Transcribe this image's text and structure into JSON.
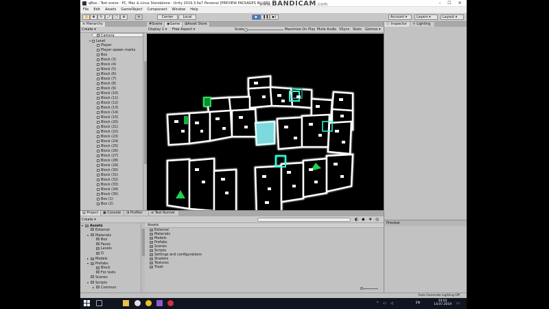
{
  "window": {
    "title": "qBox - Test scene - PC, Mac & Linux Standalone - Unity 2019.3.0a7 Personal [PREVIEW PACKAGES IN USE]",
    "watermark": "BANDICAM",
    "watermark_prefix": "www.",
    "watermark_suffix": ".com",
    "controls": [
      "–",
      "☐",
      "✕"
    ]
  },
  "menubar": [
    "File",
    "Edit",
    "Assets",
    "GameObject",
    "Component",
    "Window",
    "Help"
  ],
  "toolbar": {
    "pivot_label": "Center",
    "space_label": "Local",
    "account_label": "Account",
    "layers_label": "Layers",
    "layout_label": "Layout",
    "colors": {
      "play_active": "#3f78c9"
    }
  },
  "hierarchy": {
    "tab_label": "Hierarchy",
    "create_label": "Create",
    "search_placeholder": "All",
    "rows": [
      {
        "label": "Camera",
        "indent": 2,
        "arrow": ""
      },
      {
        "label": "Level",
        "indent": 1,
        "arrow": "▾"
      },
      {
        "label": "Player",
        "indent": 2,
        "arrow": ""
      },
      {
        "label": "Player spawn marks",
        "indent": 2,
        "arrow": ""
      },
      {
        "label": "Box",
        "indent": 2,
        "arrow": ""
      },
      {
        "label": "Block (3)",
        "indent": 2,
        "arrow": ""
      },
      {
        "label": "Block (4)",
        "indent": 2,
        "arrow": ""
      },
      {
        "label": "Block (5)",
        "indent": 2,
        "arrow": ""
      },
      {
        "label": "Block (6)",
        "indent": 2,
        "arrow": ""
      },
      {
        "label": "Block (7)",
        "indent": 2,
        "arrow": ""
      },
      {
        "label": "Block (8)",
        "indent": 2,
        "arrow": ""
      },
      {
        "label": "Block (9)",
        "indent": 2,
        "arrow": ""
      },
      {
        "label": "Block (10)",
        "indent": 2,
        "arrow": ""
      },
      {
        "label": "Block (11)",
        "indent": 2,
        "arrow": ""
      },
      {
        "label": "Block (12)",
        "indent": 2,
        "arrow": ""
      },
      {
        "label": "Block (13)",
        "indent": 2,
        "arrow": ""
      },
      {
        "label": "Block (14)",
        "indent": 2,
        "arrow": ""
      },
      {
        "label": "Block (15)",
        "indent": 2,
        "arrow": ""
      },
      {
        "label": "Block (20)",
        "indent": 2,
        "arrow": ""
      },
      {
        "label": "Block (21)",
        "indent": 2,
        "arrow": ""
      },
      {
        "label": "Block (22)",
        "indent": 2,
        "arrow": ""
      },
      {
        "label": "Block (23)",
        "indent": 2,
        "arrow": ""
      },
      {
        "label": "Block (24)",
        "indent": 2,
        "arrow": ""
      },
      {
        "label": "Block (25)",
        "indent": 2,
        "arrow": ""
      },
      {
        "label": "Block (26)",
        "indent": 2,
        "arrow": ""
      },
      {
        "label": "Block (27)",
        "indent": 2,
        "arrow": ""
      },
      {
        "label": "Block (28)",
        "indent": 2,
        "arrow": ""
      },
      {
        "label": "Block (29)",
        "indent": 2,
        "arrow": ""
      },
      {
        "label": "Block (30)",
        "indent": 2,
        "arrow": ""
      },
      {
        "label": "Block (31)",
        "indent": 2,
        "arrow": ""
      },
      {
        "label": "Block (32)",
        "indent": 2,
        "arrow": ""
      },
      {
        "label": "Block (33)",
        "indent": 2,
        "arrow": ""
      },
      {
        "label": "Block (34)",
        "indent": 2,
        "arrow": ""
      },
      {
        "label": "Block (35)",
        "indent": 2,
        "arrow": ""
      },
      {
        "label": "Box (1)",
        "indent": 2,
        "arrow": ""
      },
      {
        "label": "Box (2)",
        "indent": 2,
        "arrow": ""
      }
    ]
  },
  "center": {
    "tabs": [
      "Scene",
      "Game",
      "Asset Store"
    ],
    "game_bar": {
      "display": "Display 1",
      "aspect": "Free Aspect",
      "scale_label": "Scale",
      "scale_value": "1x",
      "maximize": "Maximize On Play",
      "mute": "Mute Audio",
      "vsync": "VSync",
      "stats": "Stats",
      "gizmos": "Gizmos"
    }
  },
  "inspector": {
    "tabs": [
      "Inspector",
      "Lighting"
    ],
    "preview_label": "Preview"
  },
  "bottom": {
    "tabs": [
      "Project",
      "Console",
      "Profiler",
      "Test Runner"
    ],
    "create_label": "Create",
    "search_placeholder": "",
    "tree": [
      {
        "label": "Assets",
        "indent": 0,
        "arrow": "▾",
        "bold": true
      },
      {
        "label": "External",
        "indent": 1,
        "arrow": ""
      },
      {
        "label": "Materials",
        "indent": 1,
        "arrow": "▾"
      },
      {
        "label": "Box",
        "indent": 2,
        "arrow": ""
      },
      {
        "label": "Faces",
        "indent": 2,
        "arrow": ""
      },
      {
        "label": "Levels",
        "indent": 2,
        "arrow": ""
      },
      {
        "label": "Q",
        "indent": 2,
        "arrow": ""
      },
      {
        "label": "Models",
        "indent": 1,
        "arrow": "▸"
      },
      {
        "label": "Prefabs",
        "indent": 1,
        "arrow": "▾"
      },
      {
        "label": "Block",
        "indent": 2,
        "arrow": ""
      },
      {
        "label": "For tests",
        "indent": 2,
        "arrow": ""
      },
      {
        "label": "Scenes",
        "indent": 1,
        "arrow": ""
      },
      {
        "label": "Scripts",
        "indent": 1,
        "arrow": "▾"
      },
      {
        "label": "Common",
        "indent": 2,
        "arrow": "▸"
      }
    ],
    "breadcrumb": "Assets",
    "assets": [
      "External",
      "Materials",
      "Models",
      "Prefabs",
      "Scenes",
      "Scripts",
      "Settings and configurations",
      "Shaders",
      "Textures",
      "Trash"
    ]
  },
  "statusbar": {
    "text": "Auto Generate Lighting Off"
  },
  "taskbar": {
    "lang": "EN",
    "time": "20:02",
    "date": "14.07.2019"
  }
}
